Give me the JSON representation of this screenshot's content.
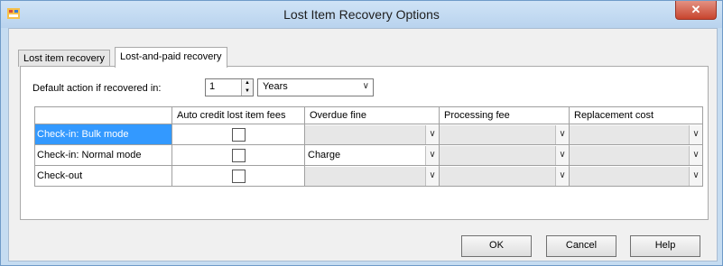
{
  "window": {
    "title": "Lost Item Recovery Options",
    "close_glyph": "✕",
    "accent": "#3399ff"
  },
  "tabs": [
    {
      "label": "Lost item recovery"
    },
    {
      "label": "Lost-and-paid recovery",
      "active": true
    }
  ],
  "default_action": {
    "label": "Default action if recovered in:",
    "number": "1",
    "unit": "Years"
  },
  "grid": {
    "columns": [
      "",
      "Auto credit lost item fees",
      "Overdue fine",
      "Processing fee",
      "Replacement cost"
    ],
    "rows": [
      {
        "label": "Check-in: Bulk mode",
        "selected": true,
        "overdue": "",
        "processing": "",
        "replacement": ""
      },
      {
        "label": "Check-in: Normal mode",
        "overdue": "Charge",
        "processing": "",
        "replacement": ""
      },
      {
        "label": "Check-out",
        "overdue": "",
        "processing": "",
        "replacement": ""
      }
    ]
  },
  "buttons": {
    "ok": "OK",
    "cancel": "Cancel",
    "help": "Help"
  }
}
